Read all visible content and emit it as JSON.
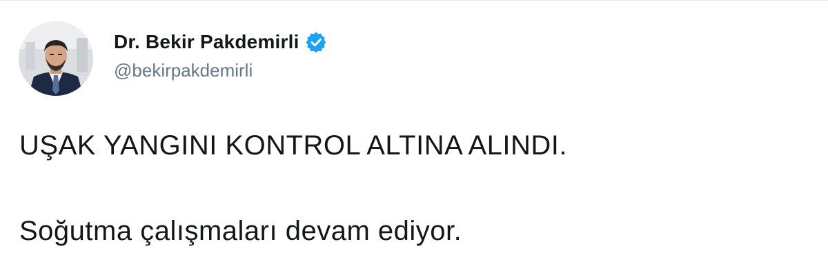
{
  "author": {
    "display_name": "Dr. Bekir Pakdemirli",
    "handle": "@bekirpakdemirli",
    "verified_icon": "verified-badge-icon",
    "avatar_icon": "profile-photo"
  },
  "tweet": {
    "lines": [
      "UŞAK YANGINI KONTROL ALTINA ALINDI.",
      "Soğutma çalışmaları devam ediyor."
    ]
  },
  "colors": {
    "name": "#14171a",
    "handle": "#657786",
    "verified": "#1da1f2",
    "text": "#14171a"
  }
}
